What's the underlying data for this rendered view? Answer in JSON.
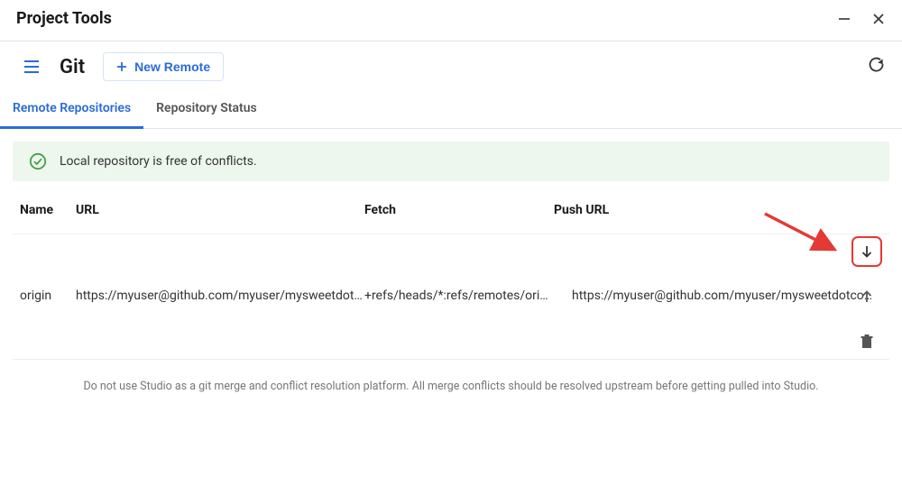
{
  "window": {
    "title": "Project Tools"
  },
  "toolbar": {
    "title": "Git",
    "new_remote_label": "New Remote"
  },
  "tabs": {
    "remote": "Remote Repositories",
    "status": "Repository Status"
  },
  "status": {
    "message": "Local repository is free of conflicts."
  },
  "columns": {
    "name": "Name",
    "url": "URL",
    "fetch": "Fetch",
    "push": "Push URL"
  },
  "rows": [
    {
      "name": "origin",
      "url": "https://myuser@github.com/myuser/mysweetdotcom.git",
      "fetch": "+refs/heads/*:refs/remotes/origin/*",
      "push_url": "https://myuser@github.com/myuser/mysweetdotcom.git"
    }
  ],
  "footer": {
    "note": "Do not use Studio as a git merge and conflict resolution platform. All merge conflicts should be resolved upstream before getting pulled into Studio."
  }
}
